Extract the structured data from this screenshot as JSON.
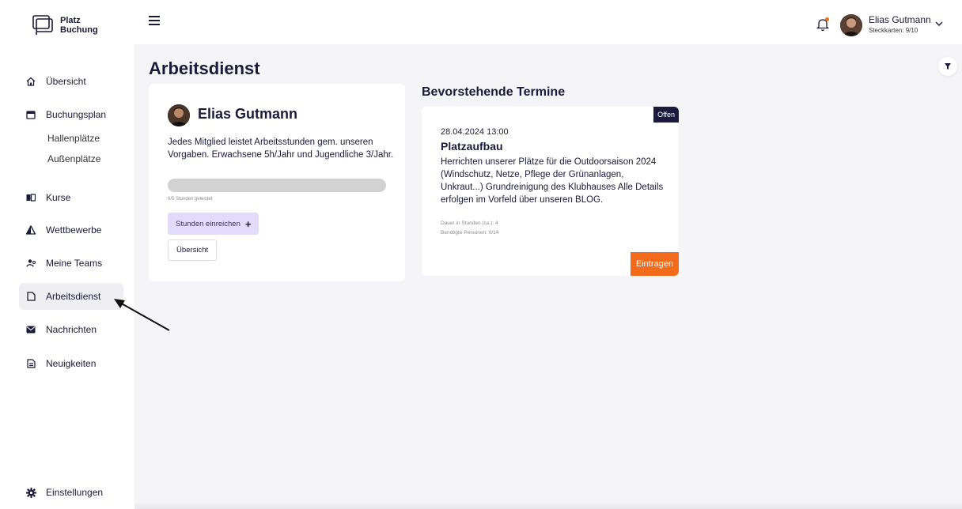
{
  "app": {
    "logo_line1": "Platz",
    "logo_line2": "Buchung"
  },
  "user": {
    "name": "Elias Gutmann",
    "subtitle": "Steckkarten: 9/10"
  },
  "colors": {
    "primary": "#1b1a3a",
    "accent": "#f26a1b",
    "purple_light": "#e2dcfa"
  },
  "sidebar": {
    "items": [
      {
        "label": "Übersicht",
        "icon": "home-icon"
      },
      {
        "label": "Buchungsplan",
        "icon": "calendar-icon"
      },
      {
        "label": "Kurse",
        "icon": "book-icon"
      },
      {
        "label": "Wettbewerbe",
        "icon": "triangle-icon"
      },
      {
        "label": "Meine Teams",
        "icon": "team-icon"
      },
      {
        "label": "Arbeitsdienst",
        "icon": "document-icon",
        "active": true
      },
      {
        "label": "Nachrichten",
        "icon": "mail-icon"
      },
      {
        "label": "Neuigkeiten",
        "icon": "news-icon"
      },
      {
        "label": "Einstellungen",
        "icon": "gear-icon"
      }
    ],
    "sub_items": [
      "Hallenplätze",
      "Außenplätze"
    ]
  },
  "page": {
    "title": "Arbeitsdienst"
  },
  "summary": {
    "name": "Elias Gutmann",
    "description": "Jedes Mitglied leistet Arbeitsstunden gem. unseren Vorgaben. Erwachsene 5h/Jahr und Jugendliche 3/Jahr.",
    "progress_fraction": 0,
    "progress_label": "0/5 Stunden geleistet",
    "submit_label": "Stunden einreichen",
    "overview_label": "Übersicht"
  },
  "upcoming": {
    "title": "Bevorstehende Termine",
    "event": {
      "status": "Offen",
      "date": "28.04.2024 13:00",
      "title": "Platzaufbau",
      "description": "Herrichten unserer Plätze für die Outdoorsaison 2024 (Windschutz, Netze, Pflege der Grünanlagen, Unkraut...) Grundreinigung des Klubhauses Alle Details erfolgen im Vorfeld über unseren BLOG.",
      "duration_label": "Dauer in Stunden (ca.):",
      "duration_value": "4",
      "persons_label": "Benötigte Personen:",
      "persons_value": "0/14",
      "action_label": "Eintragen"
    }
  }
}
